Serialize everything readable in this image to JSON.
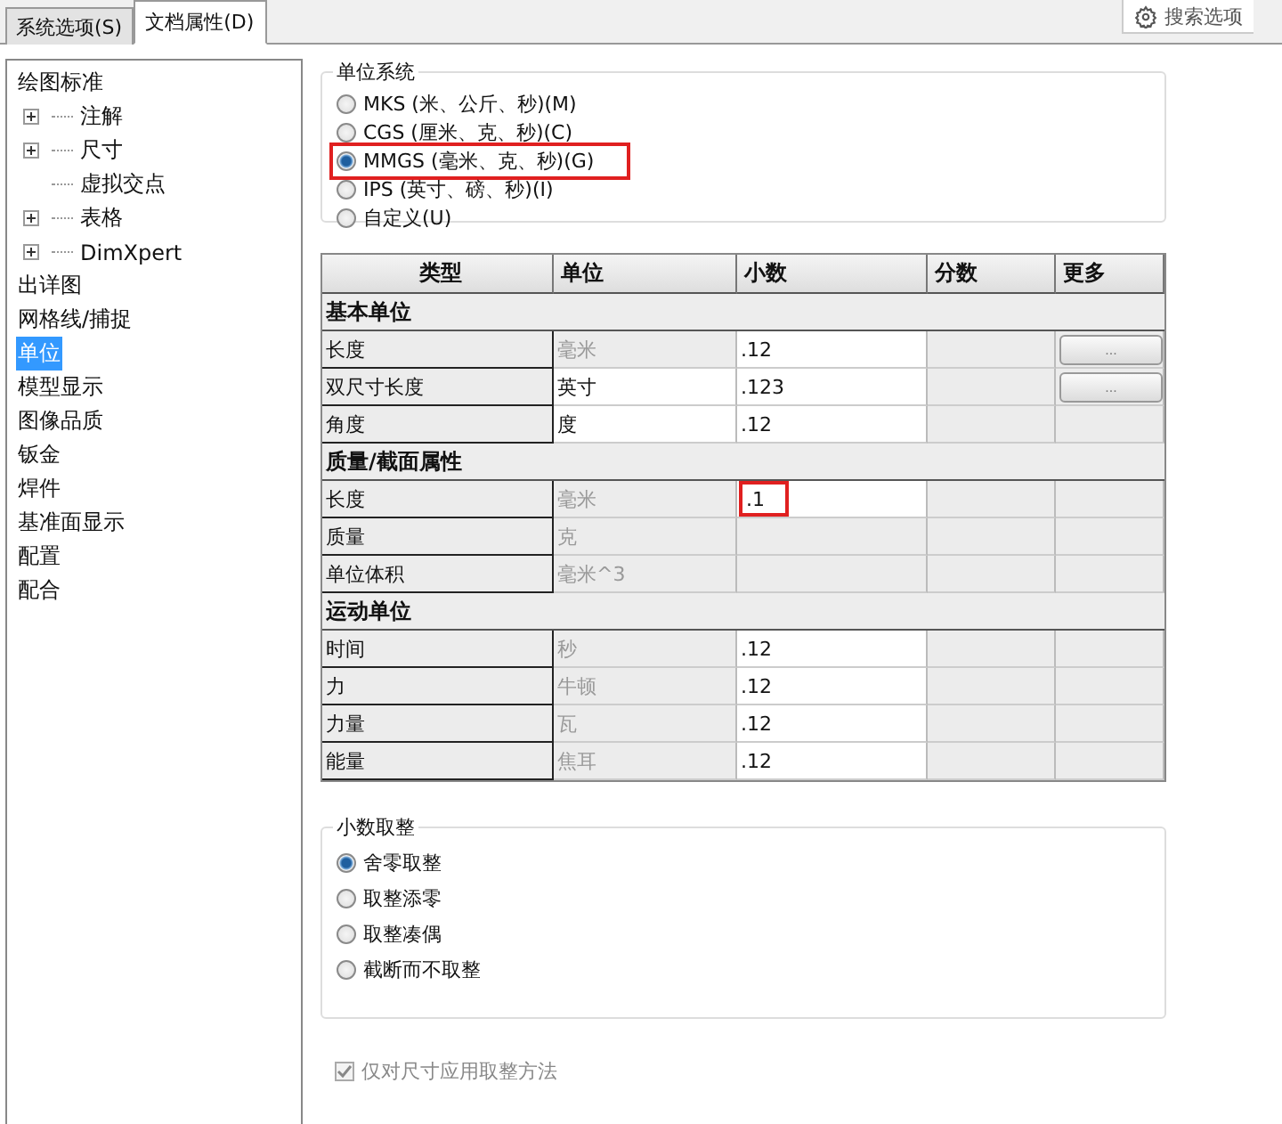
{
  "tabs": [
    {
      "label": "系统选项(S)",
      "selected": false
    },
    {
      "label": "文档属性(D)",
      "selected": true
    }
  ],
  "search": {
    "label": "搜索选项"
  },
  "tree": [
    {
      "label": "绘图标准",
      "selected": false,
      "children": [
        {
          "label": "注解",
          "expandable": true,
          "selected": false
        },
        {
          "label": "尺寸",
          "expandable": true,
          "selected": false
        },
        {
          "label": "虚拟交点",
          "expandable": false,
          "selected": false
        },
        {
          "label": "表格",
          "expandable": true,
          "selected": false
        },
        {
          "label": "DimXpert",
          "expandable": true,
          "selected": false
        }
      ]
    },
    {
      "label": "出详图",
      "selected": false
    },
    {
      "label": "网格线/捕捉",
      "selected": false
    },
    {
      "label": "单位",
      "selected": true
    },
    {
      "label": "模型显示",
      "selected": false
    },
    {
      "label": "图像品质",
      "selected": false
    },
    {
      "label": "钣金",
      "selected": false
    },
    {
      "label": "焊件",
      "selected": false
    },
    {
      "label": "基准面显示",
      "selected": false
    },
    {
      "label": "配置",
      "selected": false
    },
    {
      "label": "配合",
      "selected": false
    }
  ],
  "unit_system": {
    "title": "单位系统",
    "options": [
      {
        "label": "MKS (米、公斤、秒)(M)",
        "selected": false,
        "highlighted": false
      },
      {
        "label": "CGS (厘米、克、秒)(C)",
        "selected": false,
        "highlighted": false
      },
      {
        "label": "MMGS (毫米、克、秒)(G)",
        "selected": true,
        "highlighted": true
      },
      {
        "label": "IPS (英寸、磅、秒)(I)",
        "selected": false,
        "highlighted": false
      },
      {
        "label": "自定义(U)",
        "selected": false,
        "highlighted": false
      }
    ]
  },
  "table": {
    "columns": [
      "类型",
      "单位",
      "小数",
      "分数",
      "更多"
    ],
    "rows": [
      {
        "kind": "section",
        "label": "基本单位"
      },
      {
        "kind": "row",
        "type": "长度",
        "unit": "毫米",
        "unit_editable": false,
        "decimal": ".12",
        "decimal_editable": true,
        "decimal_highlighted": false,
        "more_button": "...",
        "more": true
      },
      {
        "kind": "row",
        "type": "双尺寸长度",
        "unit": "英寸",
        "unit_editable": true,
        "decimal": ".123",
        "decimal_editable": true,
        "decimal_highlighted": false,
        "more_button": "...",
        "more": true
      },
      {
        "kind": "row",
        "type": "角度",
        "unit": "度",
        "unit_editable": true,
        "decimal": ".12",
        "decimal_editable": true,
        "decimal_highlighted": false,
        "more": false
      },
      {
        "kind": "section",
        "label": "质量/截面属性"
      },
      {
        "kind": "row",
        "type": "长度",
        "unit": "毫米",
        "unit_editable": false,
        "decimal": ".1",
        "decimal_editable": true,
        "decimal_highlighted": true,
        "more": false
      },
      {
        "kind": "row",
        "type": "质量",
        "unit": "克",
        "unit_editable": false,
        "decimal_editable": false,
        "decimal_highlighted": false,
        "more": false
      },
      {
        "kind": "row",
        "type": "单位体积",
        "unit": "毫米^3",
        "unit_editable": false,
        "decimal_editable": false,
        "decimal_highlighted": false,
        "more": false
      },
      {
        "kind": "section",
        "label": "运动单位"
      },
      {
        "kind": "row",
        "type": "时间",
        "unit": "秒",
        "unit_editable": false,
        "decimal": ".12",
        "decimal_editable": true,
        "decimal_highlighted": false,
        "more": false
      },
      {
        "kind": "row",
        "type": "力",
        "unit": "牛顿",
        "unit_editable": false,
        "decimal": ".12",
        "decimal_editable": true,
        "decimal_highlighted": false,
        "more": false
      },
      {
        "kind": "row",
        "type": "力量",
        "unit": "瓦",
        "unit_editable": false,
        "decimal": ".12",
        "decimal_editable": true,
        "decimal_highlighted": false,
        "more": false
      },
      {
        "kind": "row",
        "type": "能量",
        "unit": "焦耳",
        "unit_editable": false,
        "decimal": ".12",
        "decimal_editable": true,
        "decimal_highlighted": false,
        "more": false
      }
    ]
  },
  "rounding": {
    "title": "小数取整",
    "options": [
      {
        "label": "舍零取整",
        "selected": true
      },
      {
        "label": "取整添零",
        "selected": false
      },
      {
        "label": "取整凑偶",
        "selected": false
      },
      {
        "label": "截断而不取整",
        "selected": false
      }
    ]
  },
  "apply_checkbox": {
    "label": "仅对尺寸应用取整方法",
    "checked": true,
    "disabled": true
  }
}
